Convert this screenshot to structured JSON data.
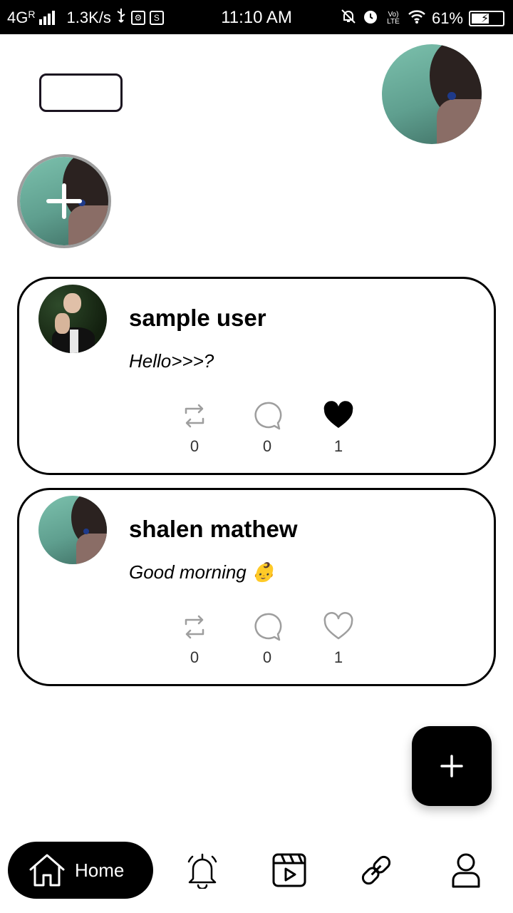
{
  "status_bar": {
    "network": "4G",
    "roaming": "R",
    "speed": "1.3K/s",
    "time": "11:10 AM",
    "volte": "Vo) LTE",
    "battery": "61%",
    "battery_level": 0.61,
    "icons": [
      "signal-icon",
      "usb-icon",
      "usb-settings-icon",
      "s-app-icon",
      "silent-icon",
      "alarm-icon",
      "volte-icon",
      "wifi-icon",
      "battery-icon"
    ]
  },
  "header": {
    "logo_icon": "logo-placeholder",
    "profile_avatar_icon": "avatar-image"
  },
  "story": {
    "add_icon": "plus-icon"
  },
  "posts": [
    {
      "username": "sample user",
      "text": "Hello>>>?",
      "reposts": "0",
      "comments": "0",
      "likes": "1",
      "liked": true
    },
    {
      "username": "shalen mathew",
      "text": "Good morning 👶",
      "reposts": "0",
      "comments": "0",
      "likes": "1",
      "liked": false
    }
  ],
  "fab": {
    "icon": "plus-icon"
  },
  "bottom_nav": {
    "home_label": "Home",
    "items": [
      "home-icon",
      "bell-icon",
      "video-icon",
      "link-icon",
      "profile-icon"
    ]
  },
  "colors": {
    "accent": "#000000",
    "action_gray": "#9e9e9e",
    "status_bar": "#000000"
  }
}
